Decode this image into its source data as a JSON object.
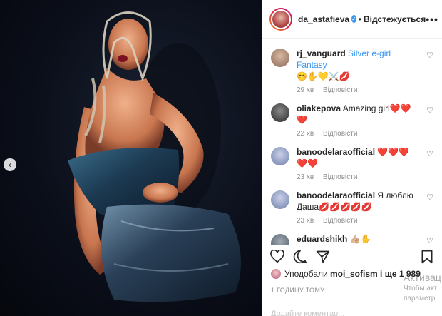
{
  "post": {
    "username": "da_astafieva",
    "follow_status": "Відстежується",
    "more": "•••"
  },
  "comments": [
    {
      "user": "rj_vanguard",
      "text": "Silver e-girl Fantasy",
      "emoji": "😊✋💛⚔️💋",
      "time": "29 хв",
      "reply": "Відповісти",
      "avatar_color": "#8a6a5a"
    },
    {
      "user": "oliakepova",
      "text": "Amazing girl❤️❤️❤️",
      "emoji": "",
      "time": "22 хв",
      "reply": "Відповісти",
      "avatar_color": "#3a3a3a"
    },
    {
      "user": "banoodelaraofficial",
      "text": "❤️❤️❤️❤️❤️",
      "emoji": "",
      "time": "23 хв",
      "reply": "Відповісти",
      "avatar_color": "#9aa4c8"
    },
    {
      "user": "banoodelaraofficial",
      "text": "Я люблю Даша💋💋💋💋💋",
      "emoji": "",
      "time": "23 хв",
      "reply": "Відповісти",
      "avatar_color": "#9aa4c8"
    },
    {
      "user": "eduardshikh",
      "text": "👍🏼✋",
      "emoji": "",
      "time": "",
      "reply": "",
      "avatar_color": "#5b6b7b"
    }
  ],
  "likes": {
    "prefix": "Уподобали",
    "user": "moi_sofism",
    "suffix": "і ще 1 989"
  },
  "time_ago": "1 ГОДИНУ ТОМУ",
  "add_comment_placeholder": "Додайте коментар...",
  "watermark": {
    "title": "Активац",
    "line1": "Чтобы акт",
    "line2": "параметр"
  },
  "icons": {
    "heart": "heart-icon",
    "comment": "comment-icon",
    "share": "share-icon",
    "bookmark": "bookmark-icon",
    "prev": "chevron-left-icon"
  },
  "colors": {
    "verified": "#3897f0",
    "meta": "#8e8e8e",
    "text": "#262626"
  }
}
